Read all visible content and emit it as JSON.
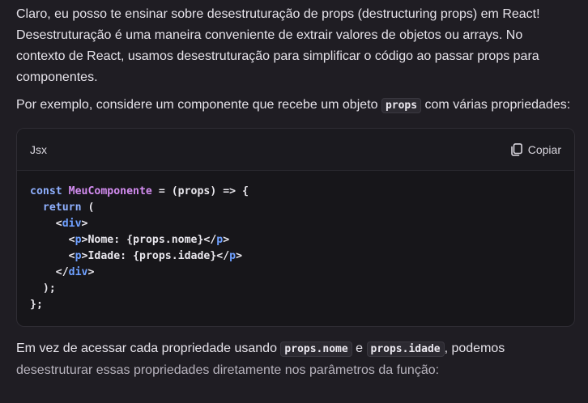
{
  "paragraphs": {
    "p1": "Claro, eu posso te ensinar sobre desestruturação de props (destructuring props) em React! Desestruturação é uma maneira conveniente de extrair valores de objetos ou arrays. No contexto de React, usamos desestruturação para simplificar o código ao passar props para componentes.",
    "p2_before": "Por exemplo, considere um componente que recebe um objeto ",
    "p2_code": "props",
    "p2_after": " com várias propriedades:",
    "p3_before": "Em vez de acessar cada propriedade usando ",
    "p3_code1": "props.nome",
    "p3_mid": " e ",
    "p3_code2": "props.idade",
    "p3_after": ", podemos",
    "p3_line2": "desestruturar essas propriedades diretamente nos parâmetros da função:"
  },
  "code_block": {
    "language": "Jsx",
    "copy_label": "Copiar",
    "lines": {
      "l1_kw": "const",
      "l1_fn": "MeuComponente",
      "l1_rest": " = (props) => {",
      "l2_kw": "return",
      "l2_rest": " (",
      "l3_open": "<",
      "l3_tag": "div",
      "l3_close": ">",
      "l4_open": "<",
      "l4_tag": "p",
      "l4_text": ">Nome: {props.nome}</",
      "l4_tag2": "p",
      "l4_close": ">",
      "l5_open": "<",
      "l5_tag": "p",
      "l5_text": ">Idade: {props.idade}</",
      "l5_tag2": "p",
      "l5_close": ">",
      "l6_open": "</",
      "l6_tag": "div",
      "l6_close": ">",
      "l7": ");",
      "l8": "};"
    }
  },
  "icons": {
    "copy": "copy-icon"
  }
}
